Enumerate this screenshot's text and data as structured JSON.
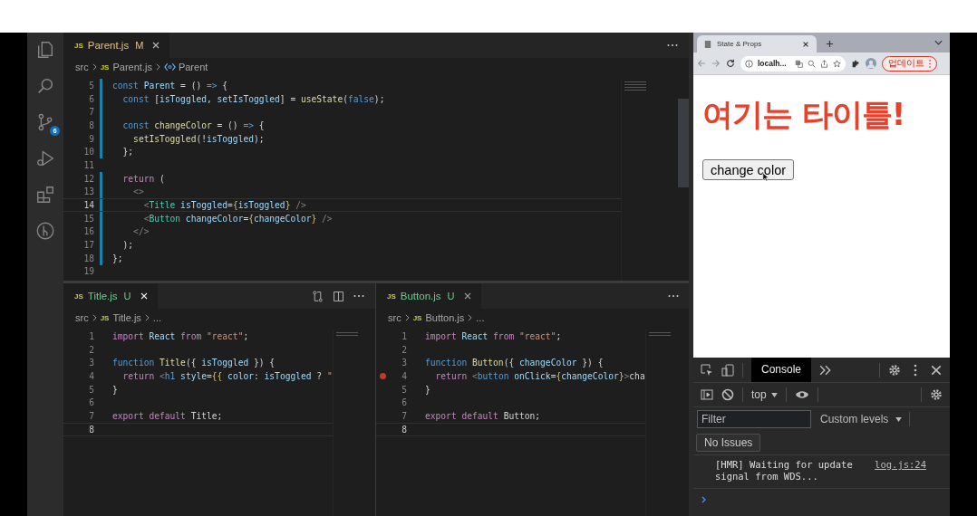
{
  "activity_bar": {
    "source_control_badge": "6"
  },
  "editor": {
    "top": {
      "tabs": [
        {
          "badge": "JS",
          "name": "Parent.js",
          "status": "M",
          "kind": "modified"
        }
      ],
      "breadcrumb": [
        {
          "kind": "folder",
          "text": "src"
        },
        {
          "kind": "file",
          "badge": "JS",
          "text": "Parent.js"
        },
        {
          "kind": "symbol",
          "text": "Parent"
        }
      ],
      "lines": [
        {
          "number": "5",
          "tokens": [
            {
              "text": "const",
              "kind": "kw"
            },
            {
              "text": " Parent",
              "kind": "var"
            },
            {
              "text": " = () ",
              "kind": "p"
            },
            {
              "text": "=>",
              "kind": "kw"
            },
            {
              "text": " {",
              "kind": "p"
            }
          ],
          "changed": true,
          "current": false,
          "breakpoint": false
        },
        {
          "number": "6",
          "tokens": [
            {
              "text": "  const",
              "kind": "kw"
            },
            {
              "text": " [",
              "kind": "p"
            },
            {
              "text": "isToggled",
              "kind": "var"
            },
            {
              "text": ", ",
              "kind": "p"
            },
            {
              "text": "setIsToggled",
              "kind": "var"
            },
            {
              "text": "] = ",
              "kind": "p"
            },
            {
              "text": "useState",
              "kind": "fn"
            },
            {
              "text": "(",
              "kind": "p"
            },
            {
              "text": "false",
              "kind": "kw"
            },
            {
              "text": ");",
              "kind": "p"
            }
          ],
          "changed": true,
          "current": false,
          "breakpoint": false
        },
        {
          "number": "7",
          "changed": true,
          "current": false,
          "breakpoint": false
        },
        {
          "number": "8",
          "tokens": [
            {
              "text": "  const",
              "kind": "kw"
            },
            {
              "text": " changeColor",
              "kind": "fn"
            },
            {
              "text": " = () ",
              "kind": "p"
            },
            {
              "text": "=>",
              "kind": "kw"
            },
            {
              "text": " {",
              "kind": "p"
            }
          ],
          "changed": true,
          "current": false,
          "breakpoint": false
        },
        {
          "number": "9",
          "tokens": [
            {
              "text": "    setIsToggled",
              "kind": "fn"
            },
            {
              "text": "(!",
              "kind": "p"
            },
            {
              "text": "isToggled",
              "kind": "var"
            },
            {
              "text": ");",
              "kind": "p"
            }
          ],
          "changed": true,
          "current": false,
          "breakpoint": false
        },
        {
          "number": "10",
          "tokens": [
            {
              "text": "  };",
              "kind": "p"
            }
          ],
          "changed": true,
          "current": false,
          "breakpoint": false
        },
        {
          "number": "11",
          "changed": false,
          "current": false,
          "breakpoint": false
        },
        {
          "number": "12",
          "tokens": [
            {
              "text": "  return",
              "kind": "ctrl"
            },
            {
              "text": " (",
              "kind": "p"
            }
          ],
          "changed": true,
          "current": false,
          "breakpoint": false
        },
        {
          "number": "13",
          "tokens": [
            {
              "text": "    <>",
              "kind": "punc"
            }
          ],
          "changed": true,
          "current": false,
          "breakpoint": false
        },
        {
          "number": "14",
          "tokens": [
            {
              "text": "      <",
              "kind": "punc"
            },
            {
              "text": "Title",
              "kind": "tag"
            },
            {
              "text": " isToggled",
              "kind": "attr"
            },
            {
              "text": "=",
              "kind": "p"
            },
            {
              "text": "{",
              "kind": "brace"
            },
            {
              "text": "isToggled",
              "kind": "var"
            },
            {
              "text": "}",
              "kind": "brace"
            },
            {
              "text": " />",
              "kind": "punc"
            }
          ],
          "changed": true,
          "current": true,
          "breakpoint": false
        },
        {
          "number": "15",
          "tokens": [
            {
              "text": "      <",
              "kind": "punc"
            },
            {
              "text": "Button",
              "kind": "tag"
            },
            {
              "text": " changeColor",
              "kind": "attr"
            },
            {
              "text": "=",
              "kind": "p"
            },
            {
              "text": "{",
              "kind": "brace"
            },
            {
              "text": "changeColor",
              "kind": "var"
            },
            {
              "text": "}",
              "kind": "brace"
            },
            {
              "text": " />",
              "kind": "punc"
            }
          ],
          "changed": true,
          "current": false,
          "breakpoint": false
        },
        {
          "number": "16",
          "tokens": [
            {
              "text": "    </>",
              "kind": "punc"
            }
          ],
          "changed": true,
          "current": false,
          "breakpoint": false
        },
        {
          "number": "17",
          "tokens": [
            {
              "text": "  );",
              "kind": "p"
            }
          ],
          "changed": true,
          "current": false,
          "breakpoint": false
        },
        {
          "number": "18",
          "tokens": [
            {
              "text": "};",
              "kind": "p"
            }
          ],
          "changed": true,
          "current": false,
          "breakpoint": false
        },
        {
          "number": "19",
          "changed": false,
          "current": false,
          "breakpoint": false
        }
      ]
    },
    "bottom": [
      {
        "tabs": [
          {
            "badge": "JS",
            "name": "Title.js",
            "status": "U",
            "kind": "untracked"
          }
        ],
        "breadcrumb": [
          {
            "kind": "folder",
            "text": "src"
          },
          {
            "kind": "file",
            "badge": "JS",
            "text": "Title.js"
          },
          {
            "kind": "symbol",
            "text": "..."
          }
        ],
        "lines": [
          {
            "number": "1",
            "tokens": [
              {
                "text": "import",
                "kind": "ctrl"
              },
              {
                "text": " React",
                "kind": "var"
              },
              {
                "text": " from",
                "kind": "ctrl"
              },
              {
                "text": " \"react\"",
                "kind": "str"
              },
              {
                "text": ";",
                "kind": "p"
              }
            ],
            "changed": false,
            "current": false,
            "breakpoint": false
          },
          {
            "number": "2",
            "changed": false,
            "current": false,
            "breakpoint": false
          },
          {
            "number": "3",
            "tokens": [
              {
                "text": "function",
                "kind": "kw"
              },
              {
                "text": " Title",
                "kind": "fn"
              },
              {
                "text": "({ ",
                "kind": "p"
              },
              {
                "text": "isToggled",
                "kind": "var"
              },
              {
                "text": " }) {",
                "kind": "p"
              }
            ],
            "changed": false,
            "current": false,
            "breakpoint": false
          },
          {
            "number": "4",
            "tokens": [
              {
                "text": "  return",
                "kind": "ctrl"
              },
              {
                "text": " <",
                "kind": "punc"
              },
              {
                "text": "h1",
                "kind": "kw"
              },
              {
                "text": " style",
                "kind": "attr"
              },
              {
                "text": "=",
                "kind": "p"
              },
              {
                "text": "{{",
                "kind": "brace"
              },
              {
                "text": " color",
                "kind": "var"
              },
              {
                "text": ": ",
                "kind": "p"
              },
              {
                "text": "isToggled",
                "kind": "var"
              },
              {
                "text": " ? ",
                "kind": "p"
              },
              {
                "text": "\"",
                "kind": "str"
              }
            ],
            "changed": false,
            "current": false,
            "breakpoint": false
          },
          {
            "number": "5",
            "tokens": [
              {
                "text": "}",
                "kind": "p"
              }
            ],
            "changed": false,
            "current": false,
            "breakpoint": false
          },
          {
            "number": "6",
            "changed": false,
            "current": false,
            "breakpoint": false
          },
          {
            "number": "7",
            "tokens": [
              {
                "text": "export default",
                "kind": "ctrl"
              },
              {
                "text": " Title;",
                "kind": "p"
              }
            ],
            "changed": false,
            "current": false,
            "breakpoint": false
          },
          {
            "number": "8",
            "changed": false,
            "current": true,
            "breakpoint": false
          }
        ]
      },
      {
        "tabs": [
          {
            "badge": "JS",
            "name": "Button.js",
            "status": "U",
            "kind": "untracked"
          }
        ],
        "breadcrumb": [
          {
            "kind": "folder",
            "text": "src"
          },
          {
            "kind": "file",
            "badge": "JS",
            "text": "Button.js"
          },
          {
            "kind": "symbol",
            "text": "..."
          }
        ],
        "lines": [
          {
            "number": "1",
            "tokens": [
              {
                "text": "import",
                "kind": "ctrl"
              },
              {
                "text": " React",
                "kind": "var"
              },
              {
                "text": " from",
                "kind": "ctrl"
              },
              {
                "text": " \"react\"",
                "kind": "str"
              },
              {
                "text": ";",
                "kind": "p"
              }
            ],
            "changed": false,
            "current": false,
            "breakpoint": false
          },
          {
            "number": "2",
            "changed": false,
            "current": false,
            "breakpoint": false
          },
          {
            "number": "3",
            "tokens": [
              {
                "text": "function",
                "kind": "kw"
              },
              {
                "text": " Button",
                "kind": "fn"
              },
              {
                "text": "({ ",
                "kind": "p"
              },
              {
                "text": "changeColor",
                "kind": "var"
              },
              {
                "text": " }) {",
                "kind": "p"
              }
            ],
            "changed": false,
            "current": false,
            "breakpoint": false
          },
          {
            "number": "4",
            "tokens": [
              {
                "text": "  return",
                "kind": "ctrl"
              },
              {
                "text": " <",
                "kind": "punc"
              },
              {
                "text": "button",
                "kind": "kw"
              },
              {
                "text": " onClick",
                "kind": "attr"
              },
              {
                "text": "=",
                "kind": "p"
              },
              {
                "text": "{",
                "kind": "brace"
              },
              {
                "text": "changeColor",
                "kind": "var"
              },
              {
                "text": "}",
                "kind": "brace"
              },
              {
                "text": ">",
                "kind": "punc"
              },
              {
                "text": "cha",
                "kind": "p"
              }
            ],
            "changed": false,
            "current": false,
            "breakpoint": true
          },
          {
            "number": "5",
            "tokens": [
              {
                "text": "}",
                "kind": "p"
              }
            ],
            "changed": false,
            "current": false,
            "breakpoint": false
          },
          {
            "number": "6",
            "changed": false,
            "current": false,
            "breakpoint": false
          },
          {
            "number": "7",
            "tokens": [
              {
                "text": "export default",
                "kind": "ctrl"
              },
              {
                "text": " Button;",
                "kind": "p"
              }
            ],
            "changed": false,
            "current": false,
            "breakpoint": false
          },
          {
            "number": "8",
            "changed": false,
            "current": true,
            "breakpoint": false
          }
        ]
      }
    ]
  },
  "browser": {
    "tab_title": "State & Props",
    "address": "localh...",
    "update_button": "업데이트",
    "page": {
      "heading": "여기는 타이틀!",
      "button": "change color"
    }
  },
  "devtools": {
    "tab": "Console",
    "context": "top",
    "filter": {
      "placeholder": "Filter"
    },
    "levels": "Custom levels",
    "issues": "No Issues",
    "messages": [
      {
        "text": "[HMR] Waiting for update signal from WDS...",
        "source": "log.js:24"
      }
    ]
  }
}
